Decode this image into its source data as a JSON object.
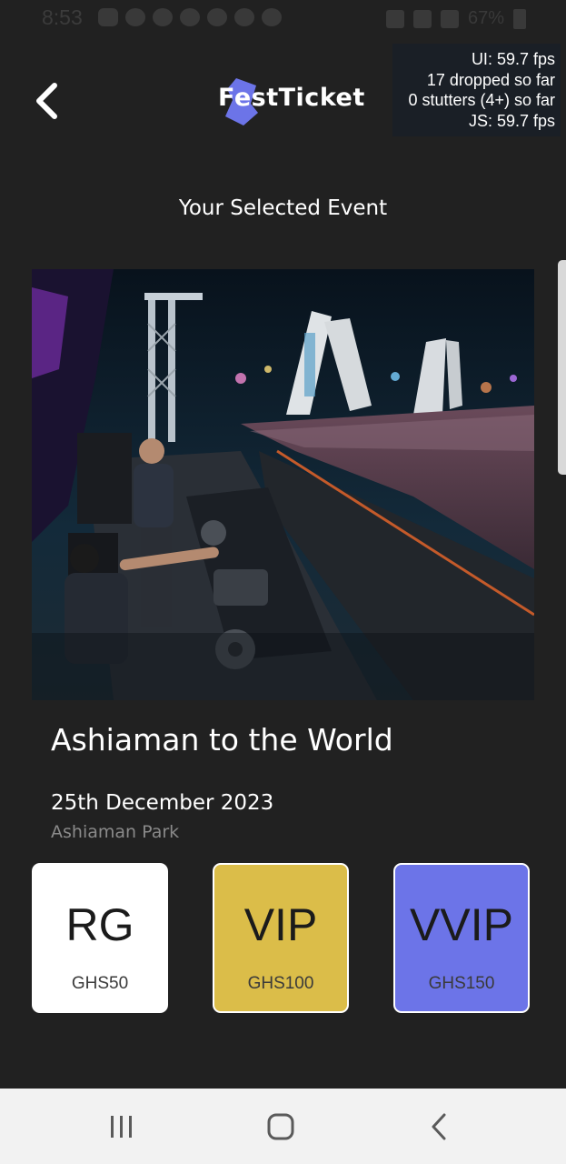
{
  "status_bar": {
    "time": "8:53",
    "battery": "67%"
  },
  "header": {
    "logo_text": "FestTicket",
    "brand_color": "#6c74e8"
  },
  "perf_overlay": {
    "lines": [
      "UI: 59.7 fps",
      "17 dropped so far",
      "0 stutters (4+) so far",
      "JS: 59.7 fps"
    ]
  },
  "page": {
    "heading": "Your Selected Event"
  },
  "event": {
    "title": "Ashiaman to the World",
    "date": "25th December 2023",
    "location": "Ashiaman Park",
    "image_icon": "festival-photo"
  },
  "tickets": [
    {
      "name": "RG",
      "price": "GHS50",
      "color": "#ffffff"
    },
    {
      "name": "VIP",
      "price": "GHS100",
      "color": "#dbbd49"
    },
    {
      "name": "VVIP",
      "price": "GHS150",
      "color": "#6c74e8"
    }
  ],
  "nav": {
    "icons": [
      "recents-icon",
      "home-icon",
      "back-icon"
    ]
  }
}
